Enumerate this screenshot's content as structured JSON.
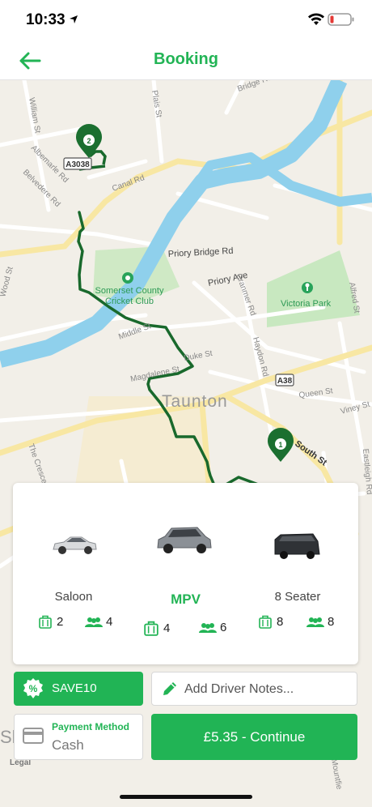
{
  "status_bar": {
    "time": "10:33"
  },
  "header": {
    "title": "Booking"
  },
  "map": {
    "labels": {
      "william_st": "William St",
      "plais_st": "Plais St",
      "bridge_rd": "Bridge Rd",
      "albemarle_rd": "Albemarle Rd",
      "belvedere_rd": "Belvedere Rd",
      "canal_rd": "Canal Rd",
      "priory_bridge_rd": "Priory Bridge Rd",
      "priory_ave": "Priory Ave",
      "cricket_club_1": "Somerset County",
      "cricket_club_2": "Cricket Club",
      "victoria_park": "Victoria Park",
      "wood_st": "Wood St",
      "middle_st": "Middle St",
      "magdalene_st": "Magdalene St",
      "duke_st": "Duke St",
      "cranmer_rd": "Cranmer Rd",
      "haydon_rd": "Haydon Rd",
      "alfred_st": "Alfred St",
      "a38": "A38",
      "a3038": "A3038",
      "taunton": "Taunton",
      "queen_st": "Queen St",
      "viney_st": "Viney St",
      "south_st": "South St",
      "the_crescent": "The Cresce",
      "eastleigh_rd": "Eastleigh Rd",
      "mountfield": "Mountfie",
      "legal": "Legal",
      "sh": "Sh"
    },
    "pins": {
      "start": "1",
      "end": "2"
    },
    "route_color": "#19692c"
  },
  "vehicles": [
    {
      "name": "Saloon",
      "luggage": "2",
      "passengers": "4",
      "selected": false
    },
    {
      "name": "MPV",
      "luggage": "4",
      "passengers": "6",
      "selected": true
    },
    {
      "name": "8 Seater",
      "luggage": "8",
      "passengers": "8",
      "selected": false
    }
  ],
  "promo": {
    "code": "SAVE10",
    "icon": "percent-badge-icon"
  },
  "notes": {
    "placeholder": "Add Driver Notes...",
    "icon": "pencil-icon"
  },
  "payment": {
    "label": "Payment Method",
    "value": "Cash",
    "icon": "credit-card-icon"
  },
  "continue": {
    "label": "£5.35 - Continue"
  },
  "colors": {
    "accent": "#22b455",
    "route": "#19692c",
    "river": "#8fd0ec",
    "park": "#c8e8c0"
  }
}
